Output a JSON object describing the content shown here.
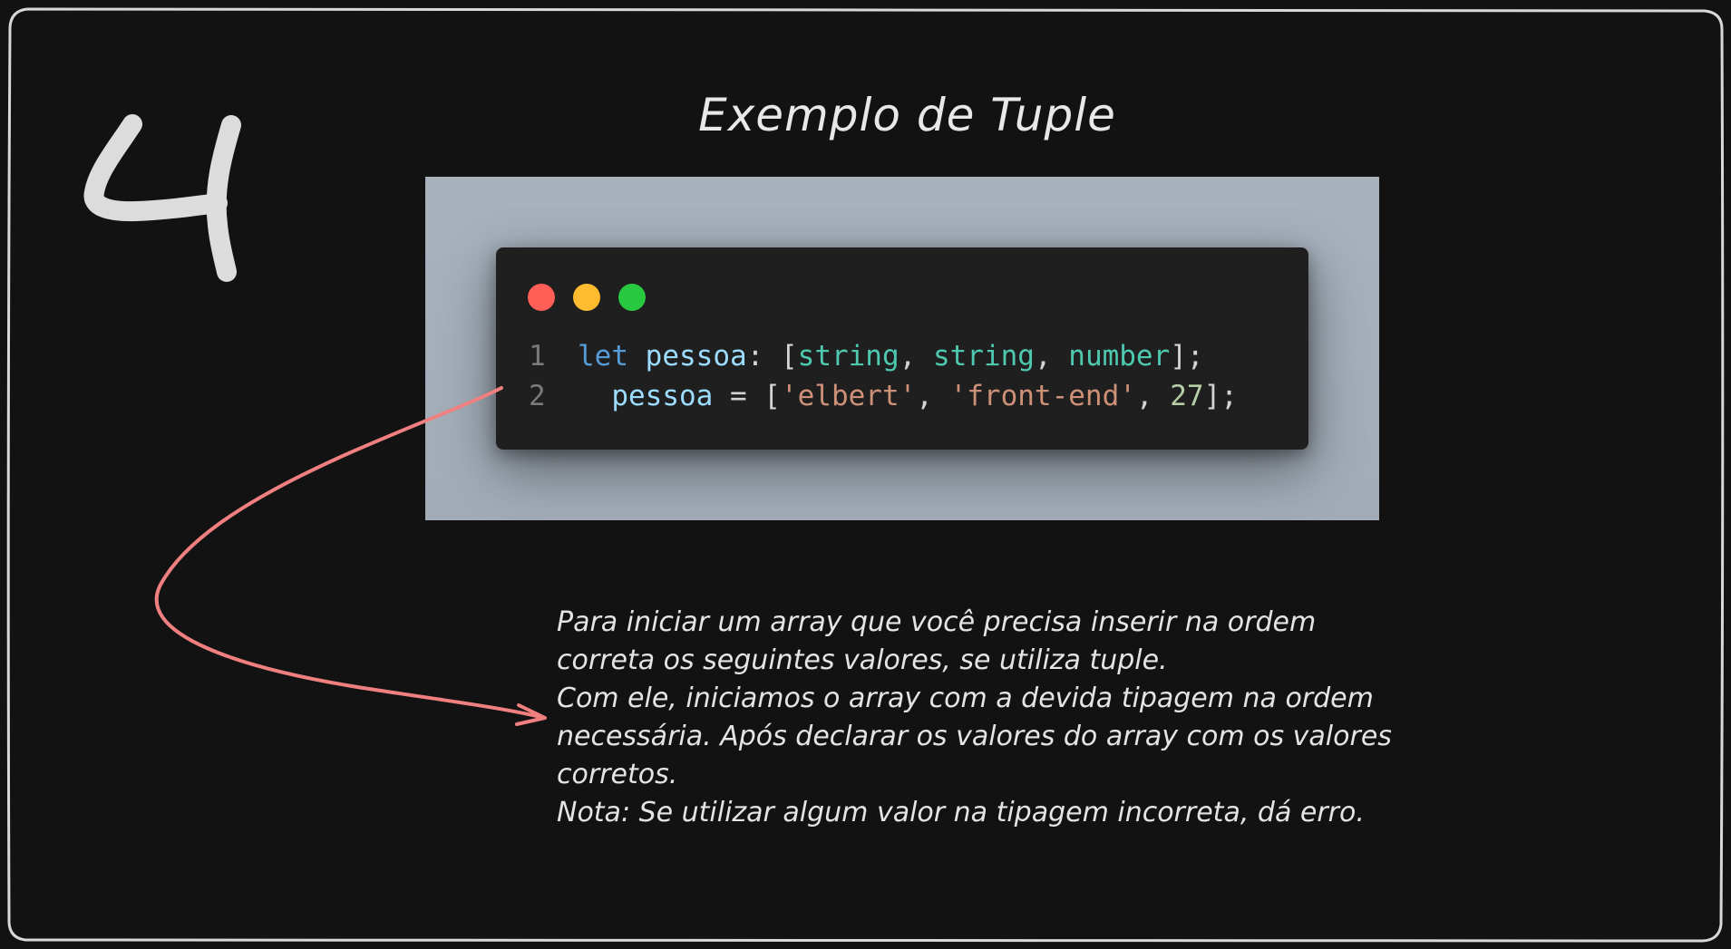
{
  "slide_number": "4",
  "title": "Exemplo de Tuple",
  "window_dots": {
    "red": "#ff5f57",
    "yellow": "#febc2e",
    "green": "#28c840"
  },
  "code": {
    "line1": {
      "number": "1",
      "keyword": "let",
      "variable": "pessoa",
      "colon": ": [",
      "type1": "string",
      "comma1": ", ",
      "type2": "string",
      "comma2": ", ",
      "type3": "number",
      "end": "];"
    },
    "line2": {
      "number": "2",
      "indent": "  ",
      "variable": "pessoa",
      "assign": " = [",
      "str1": "'elbert'",
      "comma1": ", ",
      "str2": "'front-end'",
      "comma2": ", ",
      "num": "27",
      "end": "];"
    }
  },
  "description": [
    "Para iniciar um array que você precisa inserir na ordem",
    "correta os seguintes valores, se utiliza tuple.",
    "Com ele, iniciamos o array com a devida tipagem na ordem",
    "necessária. Após declarar os valores do array com os valores",
    "corretos.",
    "Nota: Se utilizar algum valor na tipagem incorreta, dá erro."
  ],
  "colors": {
    "background": "#121212",
    "frame": "#d8d8d8",
    "arrow": "#f08080",
    "code_background": "#a8b2bd",
    "code_window": "#1f1f1f"
  }
}
